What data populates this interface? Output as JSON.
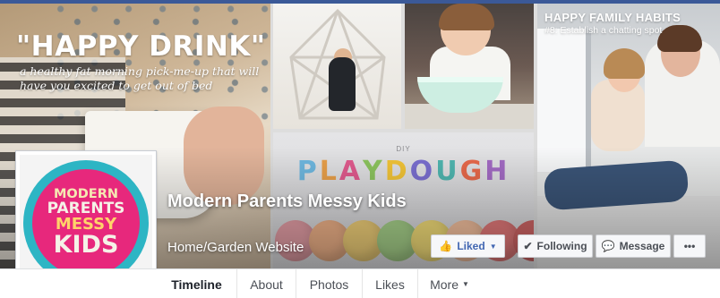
{
  "cover": {
    "panel1": {
      "title": "\"HAPPY DRINK\"",
      "subtitle": "a healthy fat morning pick-me-up that will have you excited to get out of bed"
    },
    "panel4": {
      "kicker": "DIY",
      "title_letters": [
        "P",
        "L",
        "A",
        "Y",
        "D",
        "O",
        "U",
        "G",
        "H"
      ],
      "title_colors": [
        "#6fb8e0",
        "#e9a04a",
        "#e15b8e",
        "#8cc45e",
        "#f2c437",
        "#7a6fd0",
        "#4fb6b0",
        "#e8694a",
        "#a36bc4"
      ],
      "ball_colors": [
        "#e7a0a8",
        "#f2b48a",
        "#f3d27a",
        "#a9d48c",
        "#f6e07a",
        "#f6c2a0",
        "#e47a7a",
        "#d06666"
      ]
    },
    "panel5": {
      "heading": "HAPPY FAMILY HABITS",
      "subheading": "#8: Establish a chatting spot"
    }
  },
  "profile": {
    "logo_lines": [
      "MODERN",
      "PARENTS",
      "MESSY",
      "KIDS"
    ],
    "colors": {
      "ring": "#2db5c4",
      "disc": "#e7287c"
    }
  },
  "page": {
    "name": "Modern Parents Messy Kids",
    "category": "Home/Garden Website"
  },
  "actions": {
    "liked": "Liked",
    "following": "Following",
    "message": "Message",
    "more": "•••"
  },
  "nav": {
    "tabs": [
      "Timeline",
      "About",
      "Photos",
      "Likes",
      "More"
    ]
  },
  "colors": {
    "brand": "#3b5998",
    "link_blue": "#4267b2"
  }
}
